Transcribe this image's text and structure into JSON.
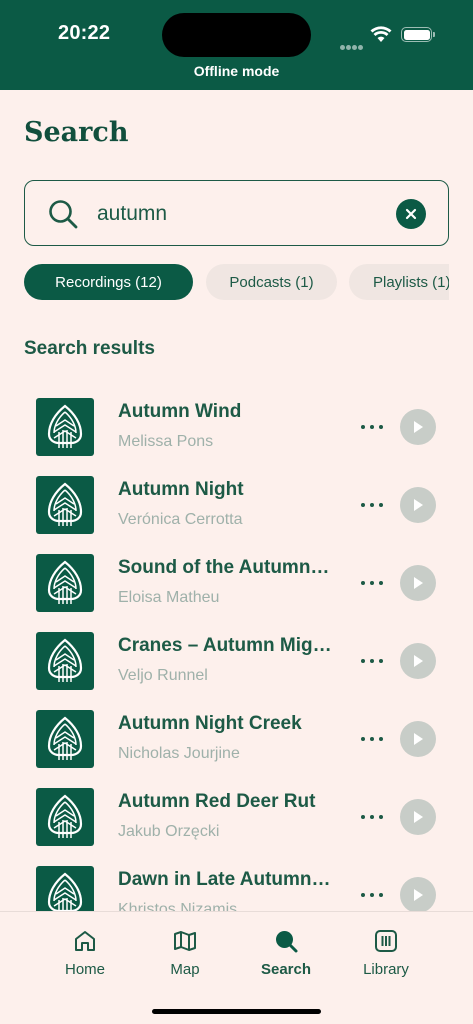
{
  "status": {
    "time": "20:22",
    "offline_label": "Offline mode"
  },
  "page": {
    "title": "Search"
  },
  "search": {
    "value": "autumn",
    "placeholder": ""
  },
  "filters": [
    {
      "label": "Recordings (12)",
      "active": true
    },
    {
      "label": "Podcasts (1)",
      "active": false
    },
    {
      "label": "Playlists (1)",
      "active": false
    }
  ],
  "results": {
    "section_title": "Search results",
    "items": [
      {
        "title": "Autumn Wind",
        "author": "Melissa Pons"
      },
      {
        "title": "Autumn Night",
        "author": "Verónica Cerrotta"
      },
      {
        "title": "Sound of the Autumn…",
        "author": "Eloisa Matheu"
      },
      {
        "title": "Cranes – Autumn Migr…",
        "author": "Veljo Runnel"
      },
      {
        "title": "Autumn Night Creek",
        "author": "Nicholas Jourjine"
      },
      {
        "title": "Autumn Red Deer Rut",
        "author": "Jakub Orzęcki"
      },
      {
        "title": "Dawn in Late Autumn…",
        "author": "Khristos Nizamis"
      }
    ]
  },
  "tabs": [
    {
      "label": "Home",
      "icon": "home-icon"
    },
    {
      "label": "Map",
      "icon": "map-icon"
    },
    {
      "label": "Search",
      "icon": "search-icon"
    },
    {
      "label": "Library",
      "icon": "library-icon"
    }
  ],
  "colors": {
    "brand": "#0b5a45",
    "background": "#fdf0ec",
    "text": "#1d5a46",
    "muted": "#9fb1aa"
  }
}
